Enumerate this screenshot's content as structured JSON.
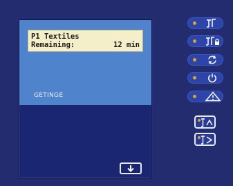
{
  "display": {
    "line1": "P1 Textiles",
    "line2_label": "Remaining:",
    "line2_value": "12 min",
    "brand": "GETINGE"
  },
  "side_buttons": [
    {
      "name": "door-open-button",
      "icon": "door-open-icon"
    },
    {
      "name": "door-lock-button",
      "icon": "door-lock-icon"
    },
    {
      "name": "cycle-button",
      "icon": "refresh-cycle-icon"
    },
    {
      "name": "power-button",
      "icon": "power-icon"
    },
    {
      "name": "alarm-button",
      "icon": "warning-triangle-icon"
    }
  ],
  "door_buttons": [
    {
      "name": "door-1-button",
      "icon": "door-1-icon"
    },
    {
      "name": "door-2-button",
      "icon": "door-2-icon"
    }
  ],
  "screen_button": {
    "icon": "arrow-down-icon"
  },
  "colors": {
    "panel": "#222c6e",
    "screen_top": "#4f84cc",
    "screen_bottom": "#1b2673",
    "lcd": "#f4efc9",
    "button": "#2d44a8",
    "indicator": "#d9a62a",
    "icon": "#ffffff"
  }
}
